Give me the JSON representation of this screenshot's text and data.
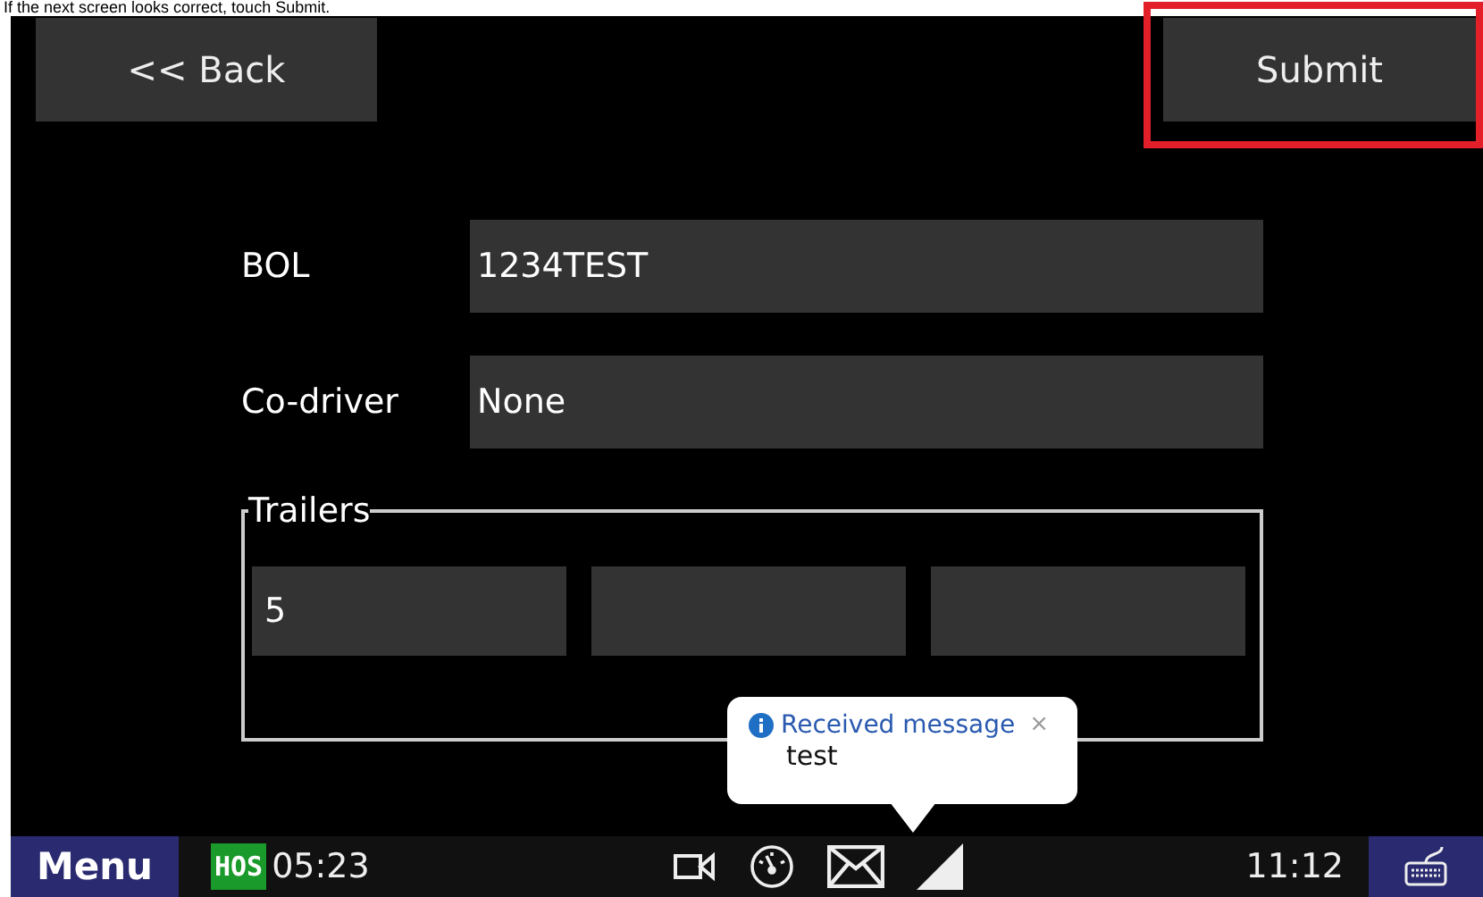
{
  "caption": "If the next screen looks correct, touch Submit.",
  "buttons": [
    {
      "label": "<< Back",
      "highlighted": false
    },
    {
      "label": "Submit",
      "highlighted": true
    }
  ],
  "fields": [
    {
      "label": "BOL",
      "value": "1234TEST"
    },
    {
      "label": "Co-driver",
      "value": "None"
    }
  ],
  "trailers": {
    "legend": "Trailers",
    "fields": [
      {
        "kind": "filled",
        "value": "5"
      },
      {
        "kind": "empty"
      },
      {
        "kind": "empty"
      }
    ]
  },
  "notification": {
    "title": "Received message",
    "close": "×",
    "body": "test"
  },
  "taskbar": {
    "menu": "Menu",
    "hos_badge": "HOS",
    "hos_time": "05:23",
    "clock": "11:12"
  }
}
